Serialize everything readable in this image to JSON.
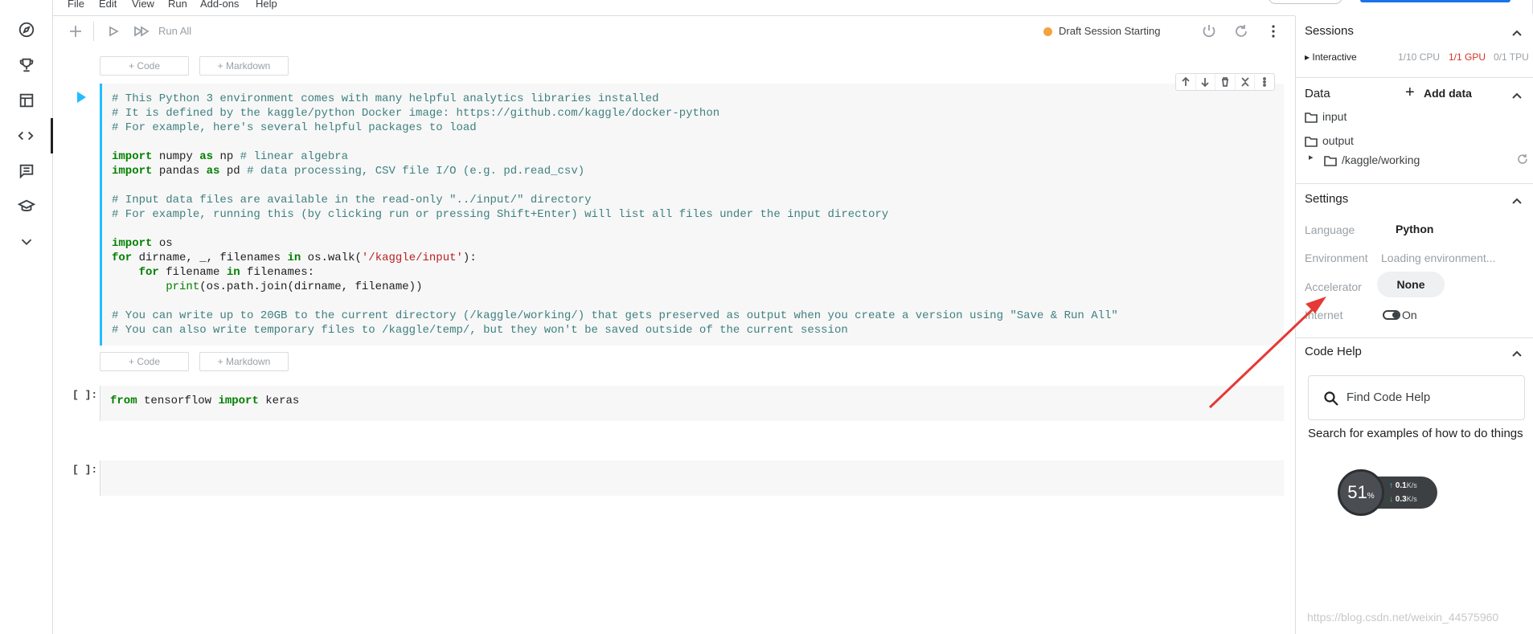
{
  "menu": [
    "File",
    "Edit",
    "View",
    "Run",
    "Add-ons",
    "Help"
  ],
  "rail_icons": [
    "compass-icon",
    "trophy-icon",
    "table-icon",
    "code-icon",
    "comments-icon",
    "school-icon",
    "chevron-down-icon"
  ],
  "toolbar": {
    "run_all": "Run All",
    "session_status": "Draft Session Starting"
  },
  "add_cell": {
    "code": "+ Code",
    "markdown": "+ Markdown"
  },
  "cells": [
    {
      "prompt": "",
      "lines": [
        "# This Python 3 environment comes with many helpful analytics libraries installed",
        "# It is defined by the kaggle/python Docker image: https://github.com/kaggle/docker-python",
        "# For example, here's several helpful packages to load",
        "",
        "import numpy as np # linear algebra",
        "import pandas as pd # data processing, CSV file I/O (e.g. pd.read_csv)",
        "",
        "# Input data files are available in the read-only \"../input/\" directory",
        "# For example, running this (by clicking run or pressing Shift+Enter) will list all files under the input directory",
        "",
        "import os",
        "for dirname, _, filenames in os.walk('/kaggle/input'):",
        "    for filename in filenames:",
        "        print(os.path.join(dirname, filename))",
        "",
        "# You can write up to 20GB to the current directory (/kaggle/working/) that gets preserved as output when you create a version using \"Save & Run All\"",
        "# You can also write temporary files to /kaggle/temp/, but they won't be saved outside of the current session"
      ]
    },
    {
      "prompt": "[ ]:",
      "lines": [
        "from tensorflow import keras"
      ]
    },
    {
      "prompt": "[ ]:",
      "lines": [
        ""
      ]
    }
  ],
  "panel": {
    "sessions": {
      "title": "Sessions",
      "type": "Interactive",
      "cpu": "1/10 CPU",
      "gpu": "1/1 GPU",
      "tpu": "0/1 TPU"
    },
    "data": {
      "title": "Data",
      "add_data": "Add data",
      "folders": [
        "input",
        "output"
      ],
      "working": "/kaggle/working"
    },
    "settings": {
      "title": "Settings",
      "language_label": "Language",
      "language_value": "Python",
      "environment_label": "Environment",
      "environment_value": "Loading environment...",
      "accelerator_label": "Accelerator",
      "accelerator_value": "None",
      "internet_label": "Internet",
      "internet_value": "On"
    },
    "code_help": {
      "title": "Code Help",
      "search_placeholder": "Find Code Help",
      "description": "Search for examples of how to do things"
    }
  },
  "network": {
    "percent": "51",
    "pct_sign": "%",
    "up": "0.1",
    "down": "0.3",
    "unit": "K/s"
  },
  "colors": {
    "accent": "#20beff",
    "status": "#f4a340",
    "gpu": "#d93025",
    "annotation_arrow": "#e53935"
  },
  "watermark": "https://blog.csdn.net/weixin_44575960"
}
